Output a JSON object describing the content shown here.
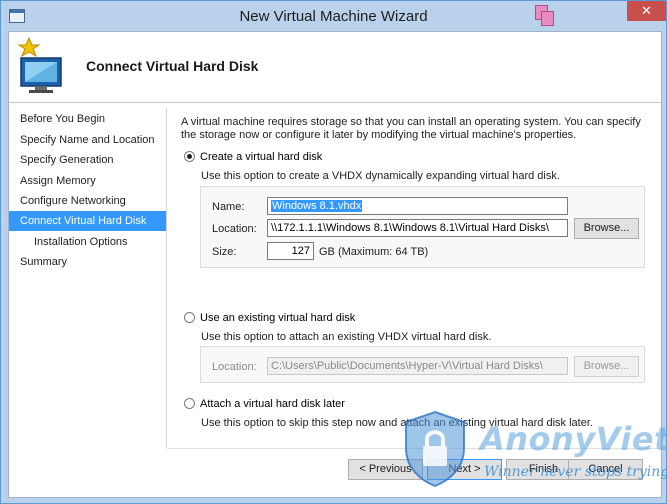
{
  "window": {
    "title": "New Virtual Machine Wizard",
    "close_glyph": "✕"
  },
  "header": {
    "title": "Connect Virtual Hard Disk"
  },
  "nav": {
    "items": [
      {
        "label": "Before You Begin"
      },
      {
        "label": "Specify Name and Location"
      },
      {
        "label": "Specify Generation"
      },
      {
        "label": "Assign Memory"
      },
      {
        "label": "Configure Networking"
      },
      {
        "label": "Connect Virtual Hard Disk",
        "active": true
      },
      {
        "label": "Installation Options",
        "sub": true
      },
      {
        "label": "Summary"
      }
    ]
  },
  "content": {
    "intro": "A virtual machine requires storage so that you can install an operating system. You can specify the storage now or configure it later by modifying the virtual machine's properties.",
    "option_create": {
      "label": "Create a virtual hard disk",
      "desc": "Use this option to create a VHDX dynamically expanding virtual hard disk.",
      "name_label": "Name:",
      "name_value": "Windows 8.1.vhdx",
      "location_label": "Location:",
      "location_value": "\\\\172.1.1.1\\Windows 8.1\\Windows 8.1\\Virtual Hard Disks\\",
      "browse": "Browse...",
      "size_label": "Size:",
      "size_value": "127",
      "size_unit": "GB (Maximum: 64 TB)"
    },
    "option_existing": {
      "label": "Use an existing virtual hard disk",
      "desc": "Use this option to attach an existing VHDX virtual hard disk.",
      "location_label": "Location:",
      "location_value": "C:\\Users\\Public\\Documents\\Hyper-V\\Virtual Hard Disks\\",
      "browse": "Browse..."
    },
    "option_later": {
      "label": "Attach a virtual hard disk later",
      "desc": "Use this option to skip this step now and attach an existing virtual hard disk later."
    }
  },
  "footer": {
    "previous": "< Previous",
    "next": "Next >",
    "finish": "Finish",
    "cancel": "Cancel"
  },
  "watermark": {
    "brand": "AnonyViet",
    "tagline": "Winner never stops trying"
  },
  "colors": {
    "accent": "#3399ff",
    "title_bar": "#b9d1ea",
    "close": "#c7504c"
  }
}
